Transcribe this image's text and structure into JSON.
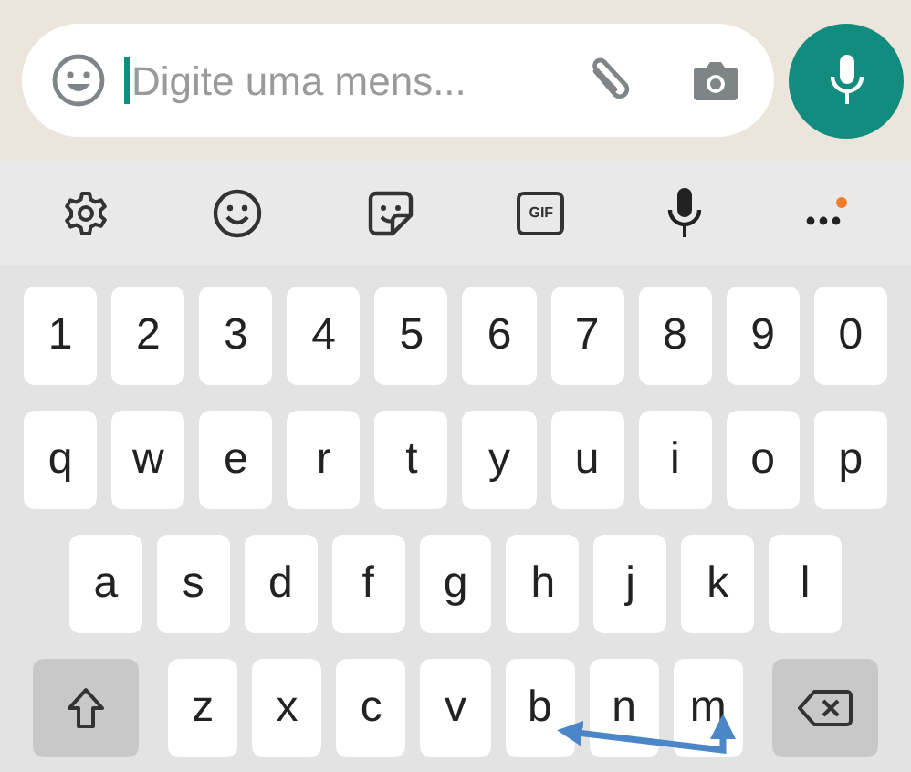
{
  "message_bar": {
    "placeholder": "Digite uma mens..."
  },
  "toolbar": {
    "gif_label": "GIF"
  },
  "keyboard": {
    "rows": [
      [
        "1",
        "2",
        "3",
        "4",
        "5",
        "6",
        "7",
        "8",
        "9",
        "0"
      ],
      [
        "q",
        "w",
        "e",
        "r",
        "t",
        "y",
        "u",
        "i",
        "o",
        "p"
      ],
      [
        "a",
        "s",
        "d",
        "f",
        "g",
        "h",
        "j",
        "k",
        "l"
      ],
      [
        {
          "kind": "shift"
        },
        {
          "kind": "char",
          "label": "z"
        },
        {
          "kind": "char",
          "label": "x"
        },
        {
          "kind": "char",
          "label": "c"
        },
        {
          "kind": "char",
          "label": "v"
        },
        {
          "kind": "char",
          "label": "b"
        },
        {
          "kind": "char",
          "label": "n"
        },
        {
          "kind": "char",
          "label": "m"
        },
        {
          "kind": "backspace"
        }
      ]
    ]
  }
}
